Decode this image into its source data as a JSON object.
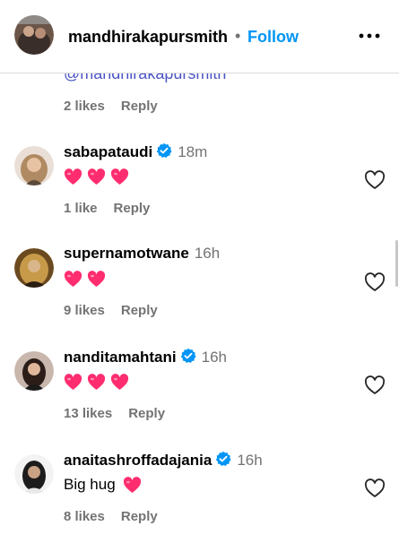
{
  "post": {
    "username": "mandhirakapursmith",
    "separator": "•",
    "follow_label": "Follow",
    "more_icon": "more-horizontal-icon"
  },
  "previous_comment": {
    "mention_text": "@mandhirakapursmith",
    "likes": "2 likes",
    "reply_label": "Reply"
  },
  "comments": [
    {
      "username": "sabapataudi",
      "verified": true,
      "time": "18m",
      "text": "",
      "emoji": [
        "heart",
        "heart",
        "heart"
      ],
      "likes": "1 like",
      "reply_label": "Reply"
    },
    {
      "username": "supernamotwane",
      "verified": false,
      "time": "16h",
      "text": "",
      "emoji": [
        "heart",
        "heart"
      ],
      "likes": "9 likes",
      "reply_label": "Reply"
    },
    {
      "username": "nanditamahtani",
      "verified": true,
      "time": "16h",
      "text": "",
      "emoji": [
        "heart",
        "heart",
        "heart"
      ],
      "likes": "13 likes",
      "reply_label": "Reply"
    },
    {
      "username": "anaitashroffadajania",
      "verified": true,
      "time": "16h",
      "text": "Big hug",
      "emoji": [
        "heart"
      ],
      "likes": "8 likes",
      "reply_label": "Reply"
    }
  ],
  "colors": {
    "link_blue": "#0095f6",
    "mention_blue": "#4b55c4",
    "verified_blue": "#0095f6",
    "muted_gray": "#737373",
    "heart_pink": "#ff2d6f"
  }
}
